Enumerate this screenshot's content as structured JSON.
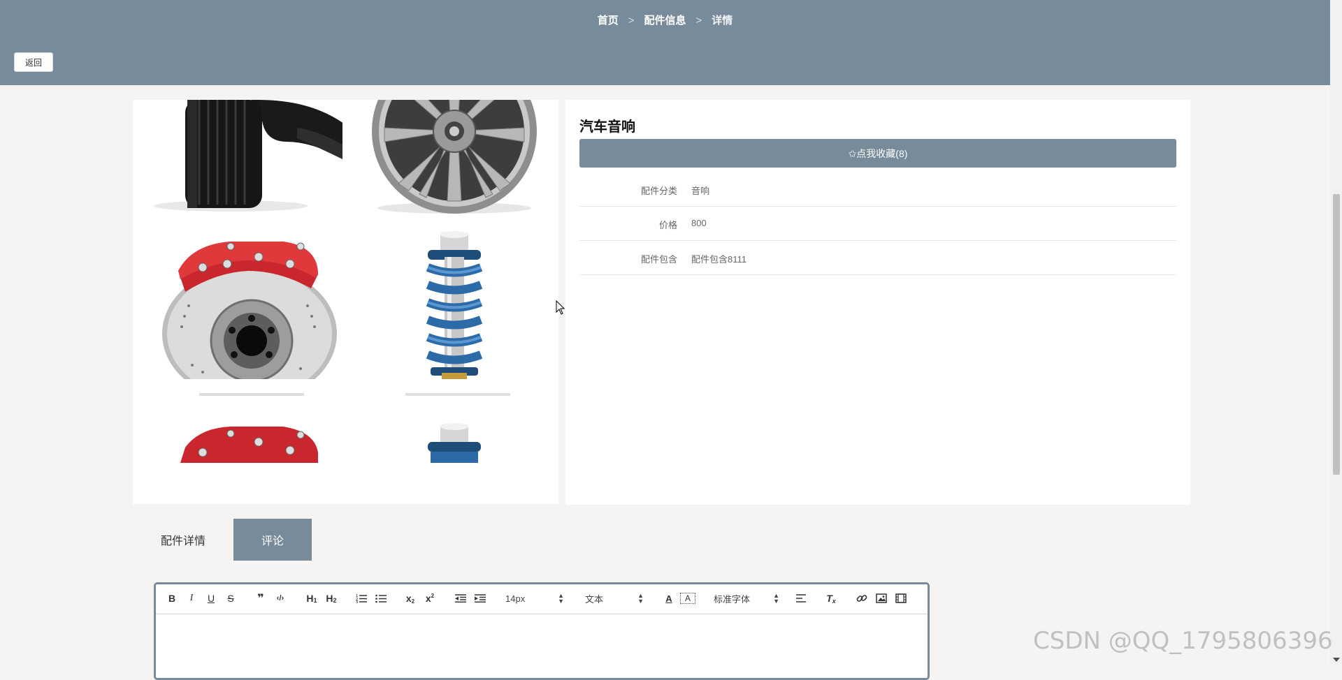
{
  "breadcrumb": {
    "home": "首页",
    "section": "配件信息",
    "current": "详情",
    "separator": ">"
  },
  "back_button": "返回",
  "product": {
    "title": "汽车音响",
    "favorite_label": "✩点我收藏(8)",
    "fields": [
      {
        "label": "配件分类",
        "value": "音响"
      },
      {
        "label": "价格",
        "value": "800"
      },
      {
        "label": "配件包含",
        "value": "配件包含8111"
      }
    ]
  },
  "gallery": {
    "tiles": [
      "tire-image",
      "rim-image",
      "brake-image",
      "shock-absorber-image"
    ]
  },
  "tabs": {
    "details": "配件详情",
    "comments": "评论"
  },
  "editor": {
    "toolbar": {
      "bold": "B",
      "italic": "I",
      "underline": "U",
      "strike": "S",
      "quote": "❞",
      "code": "‹/›",
      "h1": "H",
      "h1_sub": "1",
      "h2": "H",
      "h2_sub": "2",
      "subscript": "x",
      "subscript_sub": "2",
      "superscript": "x",
      "superscript_sup": "2",
      "font_size": "14px",
      "paragraph": "文本",
      "font_family": "标准字体",
      "color": "A",
      "background": "A",
      "clean": "T",
      "clean_sub": "x"
    }
  },
  "watermark": "CSDN @QQ_1795806396",
  "colors": {
    "accent": "#788b9b",
    "background": "#f6f4f3"
  }
}
